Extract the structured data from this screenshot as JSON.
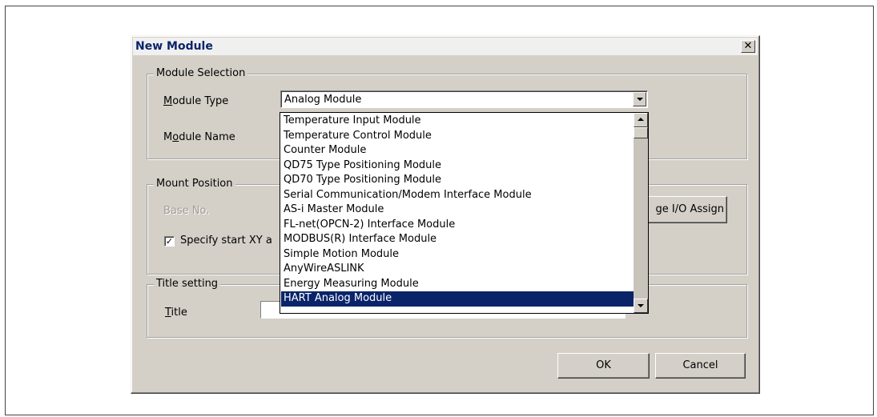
{
  "dialog": {
    "title": "New Module",
    "close_glyph": "✕"
  },
  "module_selection": {
    "group_label": "Module Selection",
    "module_type_label": "Module Type",
    "module_type_mnemonic": "M",
    "module_type_rest": "odule Type",
    "module_type_value": "Analog Module",
    "module_name_label_pre": "M",
    "module_name_label_key": "o",
    "module_name_label_post": "dule Name"
  },
  "mount_position": {
    "group_label": "Mount Position",
    "base_no_label": "Base No.",
    "specify_start_label": "Specify start XY a",
    "specify_start_checked": "✓",
    "io_assign_button": "ge I/O Assign"
  },
  "title_setting": {
    "group_label": "Title setting",
    "title_label": "Title",
    "title_value": ""
  },
  "buttons": {
    "ok": "OK",
    "cancel": "Cancel"
  },
  "dropdown": {
    "items": [
      "Temperature Input Module",
      "Temperature Control Module",
      "Counter Module",
      "QD75 Type Positioning Module",
      "QD70 Type Positioning Module",
      "Serial Communication/Modem Interface Module",
      "AS-i Master Module",
      "FL-net(OPCN-2) Interface Module",
      "MODBUS(R) Interface Module",
      "Simple Motion Module",
      "AnyWireASLINK",
      "Energy Measuring Module",
      "HART Analog Module"
    ],
    "selected_index": 12
  }
}
